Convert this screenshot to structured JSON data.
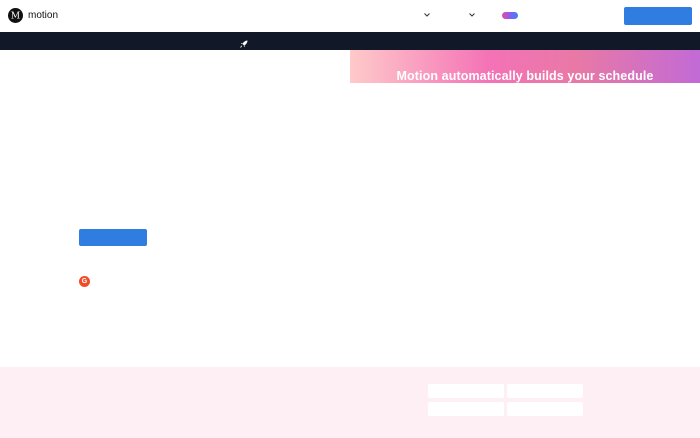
{
  "brand": {
    "name": "motion",
    "logo_glyph": "M",
    "icon": "motion-logo-icon"
  },
  "header": {
    "nav_dropdowns": [
      "chevron-down-icon",
      "chevron-down-icon"
    ],
    "cta_color": "#2f7de1"
  },
  "announcement": {
    "icon": "rocket-icon",
    "background": "#111827"
  },
  "hero": {
    "banner_title": "Motion automatically builds your schedule",
    "cta_color": "#2f7de1",
    "review_badge_glyph": "G",
    "review_badge_color": "#ef4d29"
  },
  "bottom_section": {
    "background": "#fdeff3"
  }
}
